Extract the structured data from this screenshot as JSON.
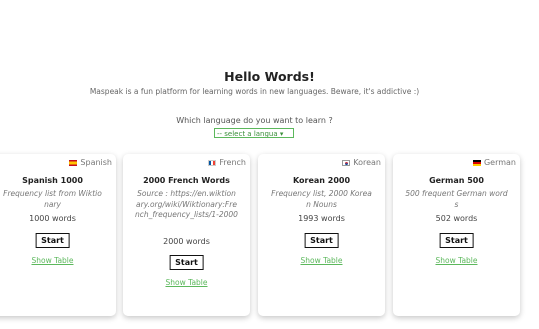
{
  "header": {
    "title": "Hello Words!",
    "subtitle": "Maspeak is a fun platform for learning words in new languages. Beware, it's addictive :)",
    "question": "Which language do you want to learn ?",
    "select_value": "-- select a langua ▾"
  },
  "cards": [
    {
      "language": "Spanish",
      "flag": "flag-es-icon",
      "title": "Spanish 1000",
      "source": "Frequency list from Wiktionary",
      "words": "1000 words",
      "start_label": "Start",
      "show_table_label": "Show Table"
    },
    {
      "language": "French",
      "flag": "flag-fr-icon",
      "title": "2000 French Words",
      "source": "Source : https://en.wiktionary.org/wiki/Wiktionary:French_frequency_lists/1-2000",
      "words": "2000 words",
      "start_label": "Start",
      "show_table_label": "Show Table"
    },
    {
      "language": "Korean",
      "flag": "flag-kr-icon",
      "title": "Korean 2000",
      "source": "Frequency list, 2000 Korean Nouns",
      "words": "1993 words",
      "start_label": "Start",
      "show_table_label": "Show Table"
    },
    {
      "language": "German",
      "flag": "flag-de-icon",
      "title": "German 500",
      "source": "500 frequent German words",
      "words": "502 words",
      "start_label": "Start",
      "show_table_label": "Show Table"
    }
  ],
  "colors": {
    "accent": "#5cb85c",
    "text": "#333333"
  }
}
